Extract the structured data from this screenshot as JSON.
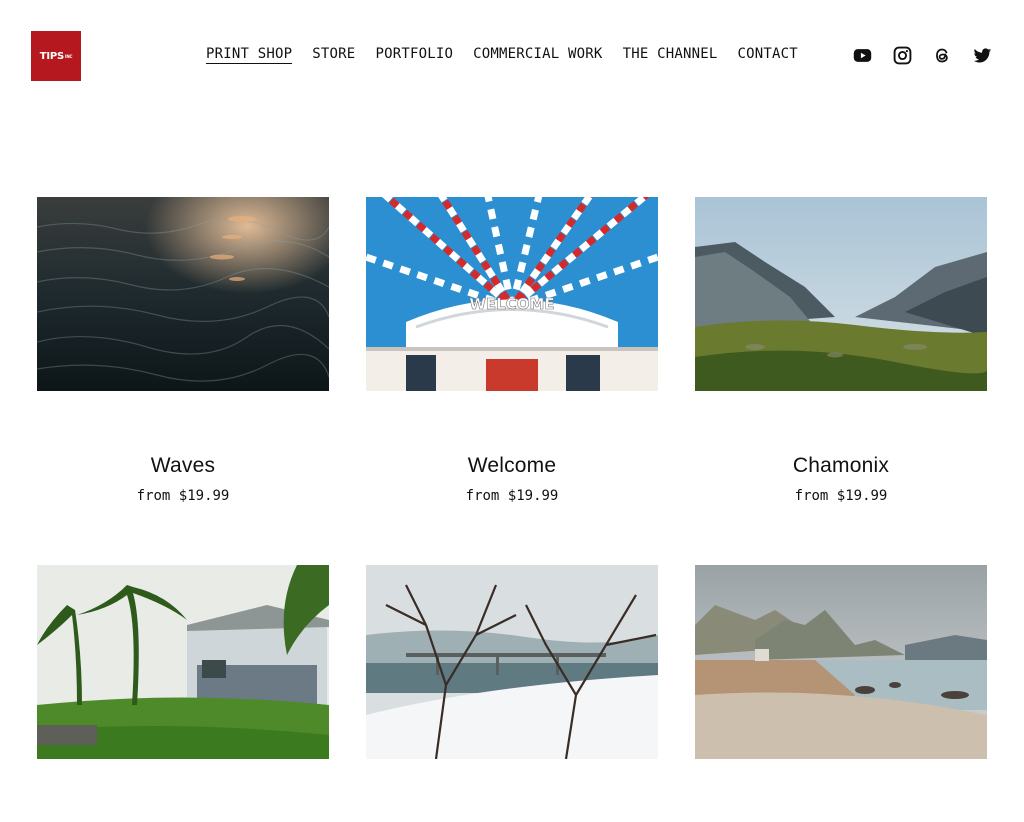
{
  "logo": {
    "text": "TIPS",
    "suffix": "INC"
  },
  "nav": [
    {
      "label": "PRINT SHOP",
      "active": true
    },
    {
      "label": "STORE"
    },
    {
      "label": "PORTFOLIO"
    },
    {
      "label": "COMMERCIAL WORK"
    },
    {
      "label": "THE CHANNEL"
    },
    {
      "label": "CONTACT"
    }
  ],
  "social": [
    "youtube-icon",
    "instagram-icon",
    "threads-icon",
    "twitter-icon"
  ],
  "products": [
    {
      "title": "Waves",
      "price": "from $19.99"
    },
    {
      "title": "Welcome",
      "price": "from $19.99"
    },
    {
      "title": "Chamonix",
      "price": "from $19.99"
    },
    {
      "title": "",
      "price": ""
    },
    {
      "title": "",
      "price": ""
    },
    {
      "title": "",
      "price": ""
    }
  ],
  "welcome_sign": "WELCOME"
}
